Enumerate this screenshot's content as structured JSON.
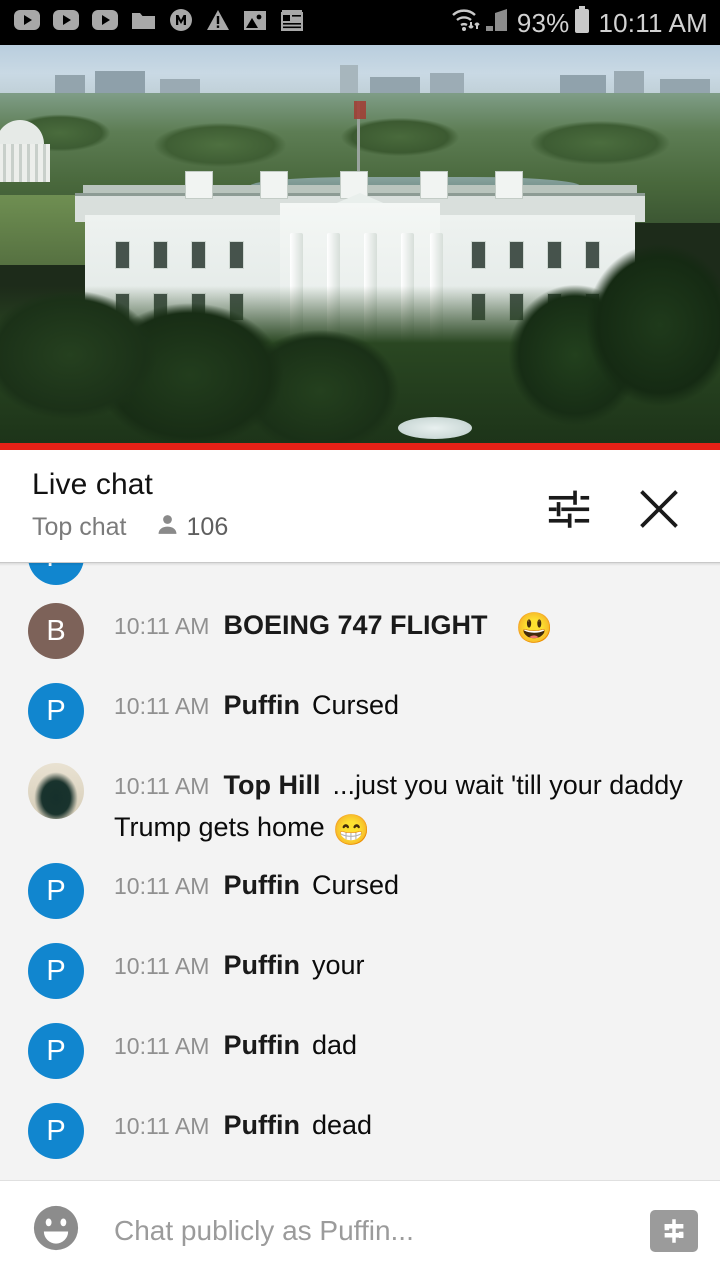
{
  "status_bar": {
    "icons": [
      "youtube-play-icon",
      "youtube-play-icon",
      "youtube-play-icon",
      "folder-icon",
      "m-circle-icon",
      "warning-triangle-icon",
      "image-icon",
      "notepad-icon"
    ],
    "wifi_icon": "wifi-transfer-icon",
    "signal_icon": "cell-signal-icon",
    "battery_percent": "93%",
    "battery_icon": "battery-icon",
    "clock": "10:11 AM"
  },
  "player": {
    "name": "white-house-live-stream",
    "progress_color": "#e62117",
    "progress_percent": 100
  },
  "chat_header": {
    "title": "Live chat",
    "subtitle": "Top chat",
    "viewers": "106",
    "viewer_icon": "person-icon",
    "settings_icon": "tune-sliders-icon",
    "close_icon": "close-x-icon"
  },
  "messages": [
    {
      "avatar_type": "letter",
      "avatar_letter": "P",
      "avatar_color": "#1186cf",
      "timestamp": "",
      "author": "",
      "text": "",
      "partial": true
    },
    {
      "avatar_type": "letter",
      "avatar_letter": "B",
      "avatar_color": "#7d6259",
      "timestamp": "10:11 AM",
      "author": "BOEING 747 FLIGHT",
      "text": "",
      "emoji": "😃"
    },
    {
      "avatar_type": "letter",
      "avatar_letter": "P",
      "avatar_color": "#1186cf",
      "timestamp": "10:11 AM",
      "author": "Puffin",
      "text": "Cursed"
    },
    {
      "avatar_type": "photo",
      "avatar_letter": "",
      "avatar_color": "#d6cdb8",
      "timestamp": "10:11 AM",
      "author": "Top Hill",
      "text": "...just you wait 'till your daddy Trump gets home",
      "emoji": "😁"
    },
    {
      "avatar_type": "letter",
      "avatar_letter": "P",
      "avatar_color": "#1186cf",
      "timestamp": "10:11 AM",
      "author": "Puffin",
      "text": "Cursed"
    },
    {
      "avatar_type": "letter",
      "avatar_letter": "P",
      "avatar_color": "#1186cf",
      "timestamp": "10:11 AM",
      "author": "Puffin",
      "text": "your"
    },
    {
      "avatar_type": "letter",
      "avatar_letter": "P",
      "avatar_color": "#1186cf",
      "timestamp": "10:11 AM",
      "author": "Puffin",
      "text": "dad"
    },
    {
      "avatar_type": "letter",
      "avatar_letter": "P",
      "avatar_color": "#1186cf",
      "timestamp": "10:11 AM",
      "author": "Puffin",
      "text": "dead"
    }
  ],
  "input_bar": {
    "emoji_icon": "emoji-smiley-icon",
    "placeholder": "Chat publicly as Puffin...",
    "superchat_icon": "dollar-superchat-icon"
  }
}
